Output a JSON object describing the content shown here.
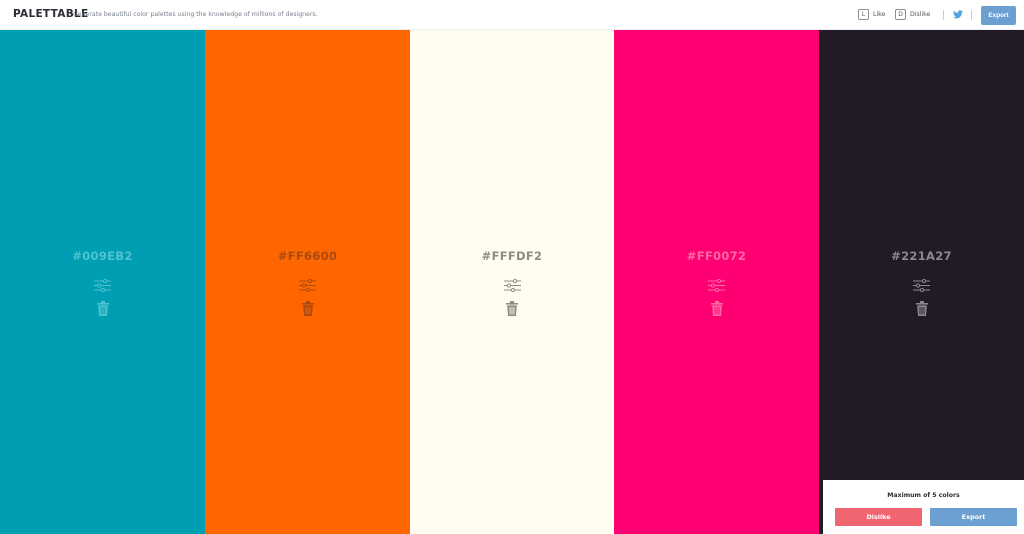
{
  "header": {
    "brand": "PALETTABLE",
    "tagline": "Generate beautiful color palettes using the knowledge of millions of designers.",
    "like_key": "L",
    "like_label": "Like",
    "dislike_key": "D",
    "dislike_label": "Dislike",
    "export_label": "Export"
  },
  "palette": [
    {
      "hex": "#009EB2",
      "bg": "#009eb2",
      "fg": "#4fc3d2"
    },
    {
      "hex": "#FF6600",
      "bg": "#ff6600",
      "fg": "#a84a12"
    },
    {
      "hex": "#FFFDF2",
      "bg": "#fffdf2",
      "fg": "#8d8b84"
    },
    {
      "hex": "#FF0072",
      "bg": "#ff0072",
      "fg": "#ff6aa6"
    },
    {
      "hex": "#221A27",
      "bg": "#221a27",
      "fg": "#8c8890"
    }
  ],
  "panel": {
    "title": "Maximum of 5 colors",
    "dislike_label": "Dislike",
    "export_label": "Export"
  },
  "colors": {
    "accent": "#6ba0d1",
    "dislike": "#f0656f",
    "twitter": "#55a6d8"
  }
}
